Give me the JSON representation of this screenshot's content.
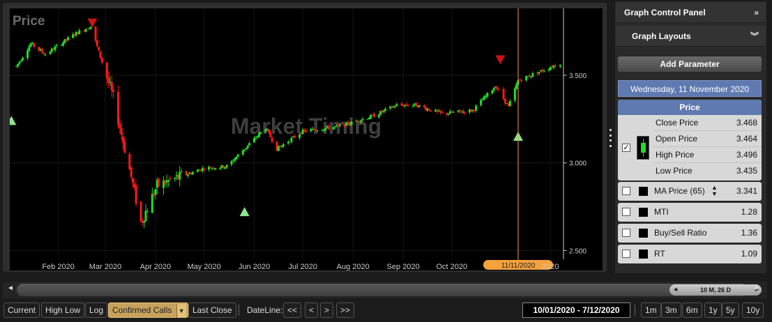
{
  "chart": {
    "title": "Price",
    "watermark": "Market Timing",
    "y_ticks": [
      "3.500",
      "3.000",
      "2.500"
    ],
    "x_ticks": [
      "Feb 2020",
      "Mar 2020",
      "Apr 2020",
      "May 2020",
      "Jun 2020",
      "Jul 2020",
      "Aug 2020",
      "Sep 2020",
      "Oct 2020",
      "2020"
    ],
    "cursor_date": "11/11/2020",
    "colors": {
      "up": "#22dd22",
      "down": "#ff1818",
      "buy_signal": "#8fe28f",
      "sell_signal": "#c81414",
      "cursor": "#f5a13c"
    }
  },
  "chart_data": {
    "type": "candlestick",
    "title": "Price",
    "ylim": [
      2.45,
      3.85
    ],
    "x_axis": "date",
    "series": [
      {
        "name": "Price",
        "x_start": "2020-01-06",
        "x_end": "2020-12-07",
        "waypoints": [
          [
            "2020-01-06",
            3.55
          ],
          [
            "2020-01-15",
            3.68
          ],
          [
            "2020-01-24",
            3.62
          ],
          [
            "2020-02-12",
            3.74
          ],
          [
            "2020-02-21",
            3.78
          ],
          [
            "2020-03-06",
            3.37
          ],
          [
            "2020-03-17",
            2.92
          ],
          [
            "2020-03-23",
            2.66
          ],
          [
            "2020-04-02",
            2.87
          ],
          [
            "2020-04-16",
            2.92
          ],
          [
            "2020-05-01",
            2.97
          ],
          [
            "2020-05-15",
            2.98
          ],
          [
            "2020-06-08",
            3.2
          ],
          [
            "2020-06-15",
            3.08
          ],
          [
            "2020-07-01",
            3.18
          ],
          [
            "2020-07-24",
            3.21
          ],
          [
            "2020-08-14",
            3.27
          ],
          [
            "2020-08-28",
            3.33
          ],
          [
            "2020-09-09",
            3.33
          ],
          [
            "2020-09-25",
            3.28
          ],
          [
            "2020-10-14",
            3.3
          ],
          [
            "2020-10-28",
            3.44
          ],
          [
            "2020-11-05",
            3.32
          ],
          [
            "2020-11-11",
            3.47
          ],
          [
            "2020-11-24",
            3.52
          ],
          [
            "2020-12-07",
            3.57
          ]
        ]
      }
    ],
    "signals": [
      {
        "type": "sell",
        "date": "2020-02-22",
        "price": 3.8
      },
      {
        "type": "buy",
        "date": "2020-01-03",
        "price": 3.24
      },
      {
        "type": "buy",
        "date": "2020-05-26",
        "price": 2.72
      },
      {
        "type": "sell",
        "date": "2020-10-31",
        "price": 3.59
      },
      {
        "type": "buy",
        "date": "2020-11-11",
        "price": 3.15
      }
    ],
    "cursor": "2020-11-11"
  },
  "panel": {
    "title": "Graph Control Panel",
    "layouts_label": "Graph Layouts",
    "add_parameter": "Add Parameter",
    "selected_date": "Wednesday, 11 November 2020",
    "price_group": {
      "title": "Price",
      "checked": true,
      "rows": [
        {
          "label": "Close Price",
          "value": "3.468"
        },
        {
          "label": "Open Price",
          "value": "3.464"
        },
        {
          "label": "High Price",
          "value": "3.496"
        },
        {
          "label": "Low Price",
          "value": "3.435"
        }
      ]
    },
    "params": [
      {
        "label": "MA Price (65)",
        "value": "3.341"
      },
      {
        "label": "MTI",
        "value": "1.28"
      },
      {
        "label": "Buy/Sell Ratio",
        "value": "1.36"
      },
      {
        "label": "RT",
        "value": "1.09"
      }
    ]
  },
  "scroll": {
    "thumb_label": "10 M, 26 D"
  },
  "toolbar": {
    "current": "Current",
    "high_low": "High Low",
    "log": "Log",
    "confirmed_calls": "Confirmed Calls",
    "last_close": "Last Close",
    "dateline_label": "DateLine:",
    "nav_first": "<<",
    "nav_prev": "<",
    "nav_next": ">",
    "nav_last": ">>",
    "date_range": "10/01/2020 - 7/12/2020",
    "ranges": [
      "1m",
      "3m",
      "6m",
      "1y",
      "5y",
      "10y"
    ]
  }
}
